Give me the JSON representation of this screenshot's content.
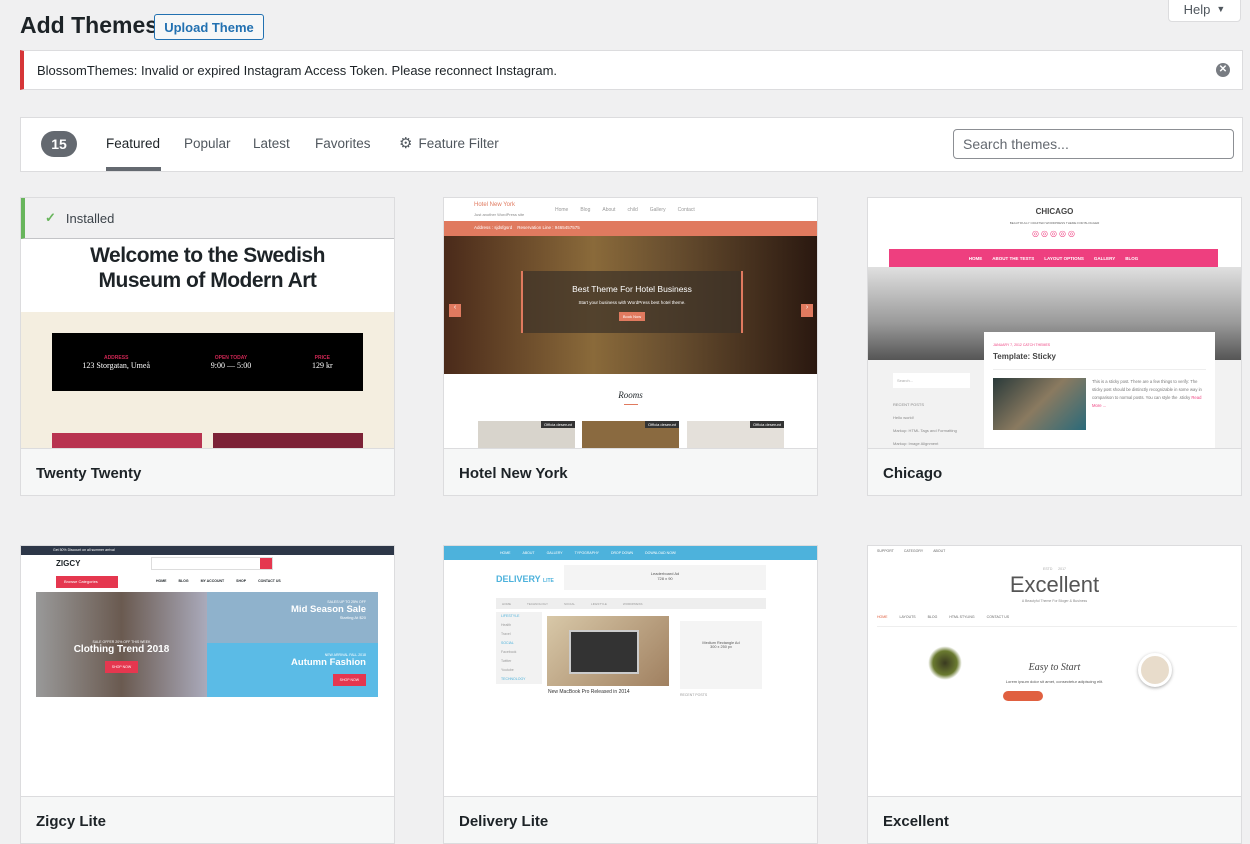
{
  "header": {
    "title": "Add Themes",
    "upload_label": "Upload Theme",
    "help_label": "Help"
  },
  "notice": {
    "text": "BlossomThemes: Invalid or expired Instagram Access Token. Please reconnect Instagram."
  },
  "filter": {
    "count": "15",
    "tabs": [
      {
        "label": "Featured",
        "active": true
      },
      {
        "label": "Popular"
      },
      {
        "label": "Latest"
      },
      {
        "label": "Favorites"
      }
    ],
    "feature_filter": "Feature Filter",
    "search_placeholder": "Search themes..."
  },
  "themes": [
    {
      "name": "Twenty Twenty",
      "installed_label": "Installed",
      "preview": {
        "headline": "Welcome to the Swedish Museum of Modern Art",
        "cols": [
          {
            "k": "ADDRESS",
            "v": "123 Storgatan, Umeå"
          },
          {
            "k": "OPEN TODAY",
            "v": "9:00 — 5:00"
          },
          {
            "k": "PRICE",
            "v": "129 kr"
          }
        ]
      }
    },
    {
      "name": "Hotel New York",
      "preview": {
        "site": "Hotel New York",
        "tagline": "Just another WordPress site",
        "nav": [
          "Home",
          "Blog",
          "About",
          "child",
          "Gallery",
          "Contact"
        ],
        "bar": "Address : sjdsfgsrd    Reservation Line : 9465457575",
        "hero": "Best Theme For Hotel Business",
        "hero_sub": "Start your business with WordPress best hotel theme.",
        "button": "Book Now",
        "section": "Rooms",
        "room_label": "Officia deserunt"
      }
    },
    {
      "name": "Chicago",
      "preview": {
        "site": "CHICAGO",
        "tagline": "BEAUTIFULLY CRAFTED WORDPRESS THEME FOR BLOGGER",
        "nav": [
          "HOME",
          "ABOUT THE TESTS",
          "LAYOUT OPTIONS",
          "GALLERY",
          "BLOG"
        ],
        "meta": "JANUARY 7, 2012 CATCH THEMES",
        "post": "Template: Sticky",
        "search": "Search...",
        "recent": "RECENT POSTS",
        "posts": [
          "Hello world!",
          "Markup: HTML Tags and Formatting",
          "Markup: Image Alignment"
        ],
        "excerpt": "This is a sticky post. There are a few things to verify: The sticky post should be distinctly recognizable in some way in comparison to normal posts. You can style the .sticky",
        "more": "Read More ..."
      }
    },
    {
      "name": "Zigcy Lite",
      "preview": {
        "topbar": "Get 50% Discount on all summer arrival",
        "logo": "ZIGCY",
        "browse": "Browse Categories",
        "nav": [
          "HOME",
          "BLOG",
          "MY ACCOUNT",
          "SHOP",
          "CONTACT US"
        ],
        "main": "Clothing Trend 2018",
        "main_sub": "SALE OFFER 20% OFF THIS WEEK",
        "b1_sub": "SALES UP TO 25% OFF",
        "b1": "Mid Season Sale",
        "b1_note": "Starting At $20",
        "b2_sub": "NEW ARRIVAL FALL 2018",
        "b2": "Autumn Fashion",
        "shop": "SHOP NOW"
      }
    },
    {
      "name": "Delivery Lite",
      "preview": {
        "nav": [
          "HOME",
          "ABOUT",
          "GALLERY",
          "TYPOGRAPHY",
          "DROP DOWN",
          "DOWNLOAD NOW!"
        ],
        "logo": "DELIVERY",
        "logo2": "LITE",
        "ad": "Leaderboard Ad",
        "ad_size": "728 x 90",
        "menu": [
          "HOME",
          "TECHNOLOGY",
          "SOCIAL",
          "LIFESTYLE",
          "WORDPRESS"
        ],
        "side": [
          "LIFESTYLE",
          "Health",
          "Travel",
          "SOCIAL",
          "Facebook",
          "Twitter",
          "Youtube",
          "TECHNOLOGY"
        ],
        "post": "New MacBook Pro Released in 2014",
        "rect": "Medium Rectangle Ad",
        "rect_size": "300 x 250 px",
        "recent": "RECENT POSTS"
      }
    },
    {
      "name": "Excellent",
      "preview": {
        "top": [
          "SUPPORT",
          "CATEGORY",
          "ABOUT"
        ],
        "estd": "ESTD      2017",
        "logo": "Excellent",
        "tagline": "A Beautyful Theme For Bloger & Business",
        "nav": [
          "HOME",
          "LAYOUTS",
          "BLOG",
          "HTML STYLING",
          "CONTACT US"
        ],
        "hero": "Easy to Start",
        "hero_sub": "Lorem ipsum dolor sit amet, consectetur adipiscing elit."
      }
    }
  ],
  "colors": {
    "accent": "#2271b1",
    "error": "#d63638",
    "installed": "#68b55c",
    "hotel": "#e07a5f",
    "chicago": "#ee3f7f",
    "zigcy": "#e5374f",
    "delivery": "#4db2dc"
  }
}
